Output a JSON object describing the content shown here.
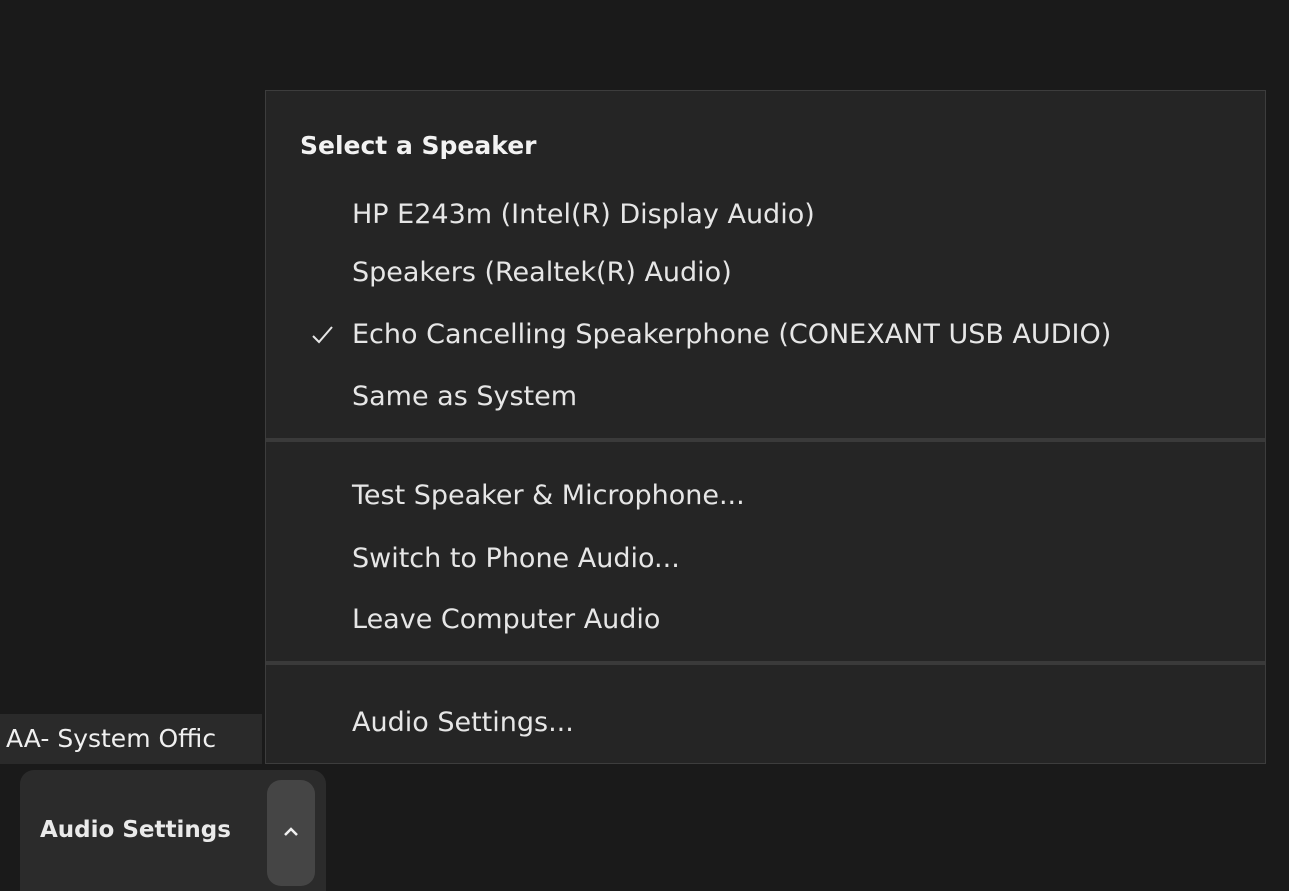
{
  "participant": {
    "name_label": "AA- System Offic"
  },
  "toolbar": {
    "audio_settings_label": "Audio Settings",
    "caret_icon": "chevron-up-icon"
  },
  "menu": {
    "speaker_header": "Select a Speaker",
    "speakers": [
      {
        "label": "HP E243m (Intel(R) Display Audio)",
        "selected": false
      },
      {
        "label": "Speakers (Realtek(R) Audio)",
        "selected": false
      },
      {
        "label": "Echo Cancelling Speakerphone (CONEXANT USB AUDIO)",
        "selected": true
      },
      {
        "label": "Same as System",
        "selected": false
      }
    ],
    "actions": [
      {
        "label": "Test Speaker & Microphone..."
      },
      {
        "label": "Switch to Phone Audio..."
      },
      {
        "label": "Leave Computer Audio"
      }
    ],
    "settings_label": "Audio Settings...",
    "check_icon": "checkmark-icon"
  },
  "colors": {
    "background": "#1a1a1a",
    "menu_bg": "#252525",
    "separator": "#3a3a3a",
    "text": "#e6e6e6"
  }
}
